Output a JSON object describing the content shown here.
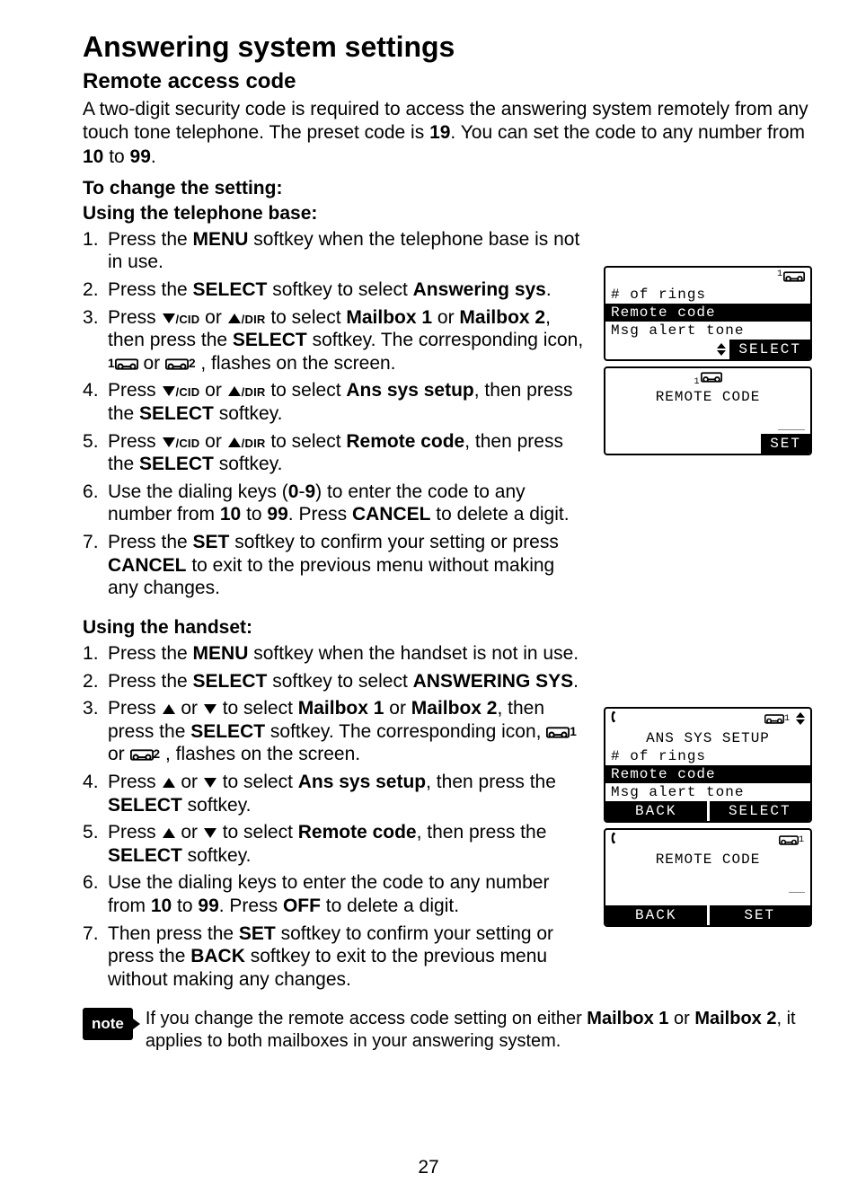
{
  "title": "Answering system settings",
  "section_heading": "Remote access code",
  "intro": {
    "pre": "A two-digit security code is required to access the answering system remotely from any touch tone telephone. The preset code is ",
    "preset_code": "19",
    "mid": ". You can set the code to any number from ",
    "lo": "10",
    "mid2": " to ",
    "hi": "99",
    "end": "."
  },
  "to_change": "To change the setting:",
  "base_heading": "Using the telephone base:",
  "base_steps": {
    "s1": {
      "a": "Press the ",
      "menu": "MENU",
      "b": " softkey when the telephone base is not in use."
    },
    "s2": {
      "a": "Press the ",
      "select": "SELECT",
      "b": " softkey to select ",
      "target": "Answering sys",
      "c": "."
    },
    "s3": {
      "a": "Press ",
      "cid": "/CID",
      "b": " or ",
      "dir": "/DIR",
      "c": " to select ",
      "mb1": "Mailbox 1",
      "d": " or ",
      "mb2": "Mailbox 2",
      "e": ", then press the ",
      "select": "SELECT",
      "f": " softkey. The corresponding icon, ",
      "g": " or ",
      "h": ", flashes on the screen."
    },
    "s4": {
      "a": "Press ",
      "cid": "/CID",
      "b": " or ",
      "dir": "/DIR",
      "c": " to select ",
      "target": "Ans sys setup",
      "d": ", then press the ",
      "select": "SELECT",
      "e": " softkey."
    },
    "s5": {
      "a": "Press ",
      "cid": "/CID",
      "b": " or ",
      "dir": "/DIR",
      "c": " to select ",
      "target": "Remote code",
      "d": ", then press the ",
      "select": "SELECT",
      "e": " softkey."
    },
    "s6": {
      "a": "Use the dialing keys (",
      "zero": "0",
      "b": "-",
      "nine": "9",
      "c": ") to enter the code to any number from ",
      "lo": "10",
      "d": " to ",
      "hi": "99",
      "e": ". Press ",
      "cancel": "CANCEL",
      "f": " to delete a digit."
    },
    "s7": {
      "a": "Press the ",
      "set": "SET",
      "b": " softkey to confirm your setting or press ",
      "cancel": "CANCEL",
      "c": " to exit to the previous menu without making any changes."
    }
  },
  "handset_heading": "Using the handset:",
  "handset_steps": {
    "s1": {
      "a": "Press the ",
      "menu": "MENU",
      "b": " softkey when the handset is not in use."
    },
    "s2": {
      "a": "Press the ",
      "select": "SELECT",
      "b": " softkey to select ",
      "target": "ANSWERING SYS",
      "c": "."
    },
    "s3": {
      "a": "Press ",
      "b": " or ",
      "c": " to select ",
      "mb1": "Mailbox 1",
      "d": " or ",
      "mb2": "Mailbox 2",
      "e": ", then press the ",
      "select": "SELECT",
      "f": " softkey. The corresponding icon, ",
      "g": " or ",
      "h": ", flashes on the screen."
    },
    "s4": {
      "a": "Press ",
      "b": " or ",
      "c": " to select ",
      "target": "Ans sys setup",
      "d": ", then press the ",
      "select": "SELECT",
      "e": " softkey."
    },
    "s5": {
      "a": "Press ",
      "b": " or ",
      "c": " to select ",
      "target": "Remote code",
      "d": ", then press the ",
      "select": "SELECT",
      "e": " softkey."
    },
    "s6": {
      "a": "Use the dialing keys to enter the code to any number from ",
      "lo": "10",
      "b": " to ",
      "hi": "99",
      "c": ". Press ",
      "off": "OFF",
      "d": " to delete a digit."
    },
    "s7": {
      "a": "Then press the ",
      "set": "SET",
      "b": " softkey to confirm your setting or press the ",
      "back": "BACK",
      "c": " softkey to exit to the previous menu without making any changes."
    }
  },
  "note": {
    "badge": "note",
    "a": "If you change the remote access code setting on either ",
    "mb1": "Mailbox 1",
    "b": " or ",
    "mb2": "Mailbox 2",
    "c": ", it applies to both mailboxes in your answering system."
  },
  "screens": {
    "base_menu": {
      "rings": "# of rings",
      "remote": "Remote code",
      "msg": "Msg alert tone",
      "select": "SELECT"
    },
    "base_remote": {
      "title": "REMOTE CODE",
      "set": "SET",
      "cursor": "_____"
    },
    "hand_menu": {
      "header": "ANS SYS SETUP",
      "rings": "# of rings",
      "remote": "Remote code",
      "msg": "Msg alert tone",
      "back": "BACK",
      "select": "SELECT"
    },
    "hand_remote": {
      "title": "REMOTE CODE",
      "back": "BACK",
      "set": "SET",
      "cursor": "___"
    }
  },
  "tape_sub": {
    "one": "1",
    "two": "2",
    "one_sup": "1",
    "two_sup": "2"
  },
  "page_number": "27"
}
